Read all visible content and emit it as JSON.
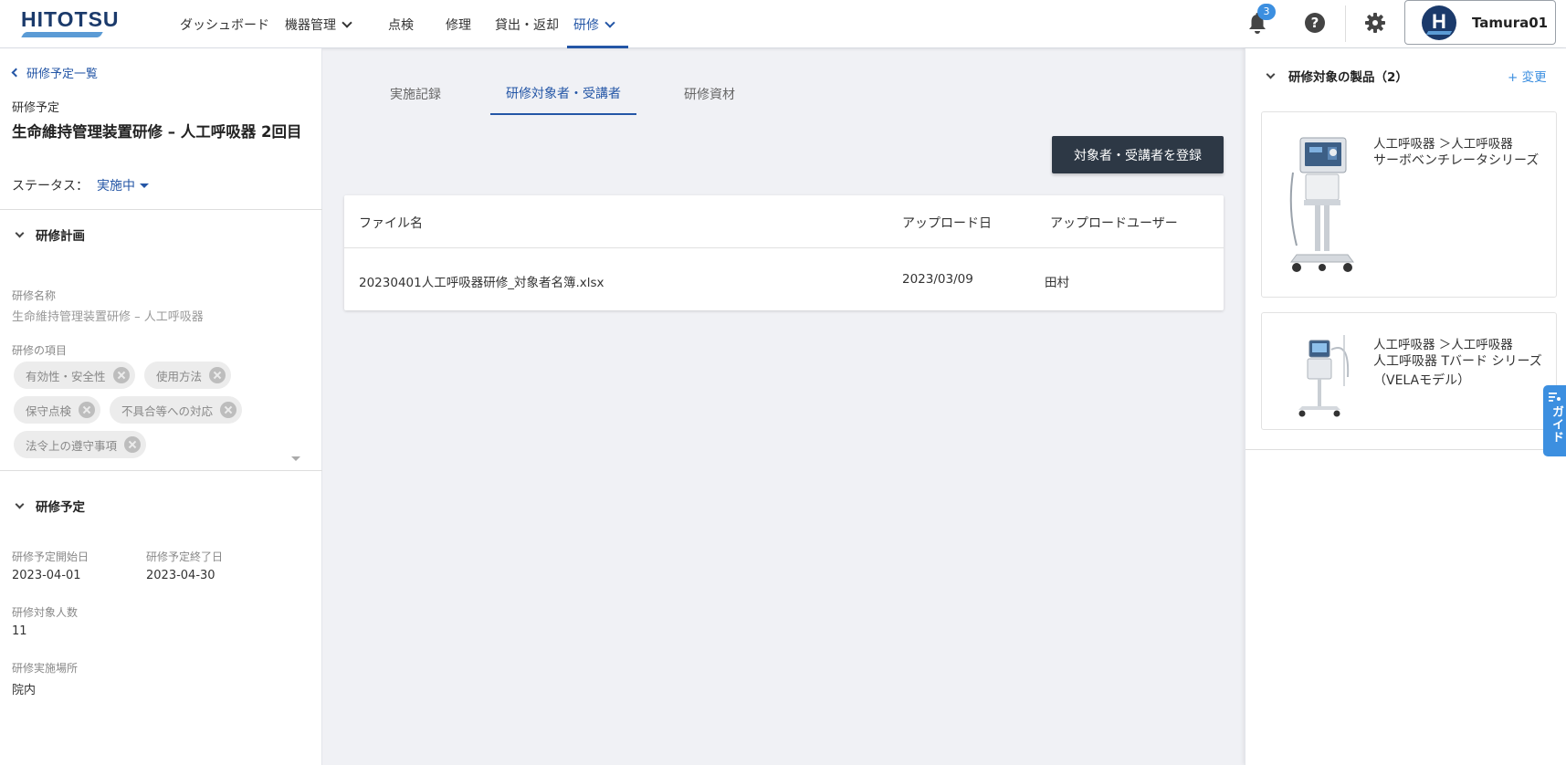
{
  "header": {
    "logo": "HITOTSU",
    "nav": [
      {
        "label": "ダッシュボード"
      },
      {
        "label": "機器管理"
      },
      {
        "label": "点検"
      },
      {
        "label": "修理"
      },
      {
        "label": "貸出・返却"
      },
      {
        "label": "研修"
      }
    ],
    "notification_count": "3",
    "help_glyph": "?",
    "avatar_initial": "H",
    "user_name": "Tamura01"
  },
  "left": {
    "back_link": "研修予定一覧",
    "schedule_label": "研修予定",
    "title": "生命維持管理装置研修 – 人工呼吸器 2回目",
    "status_label": "ステータス：",
    "status_value": "実施中",
    "plan": {
      "heading": "研修計画",
      "name_label": "研修名称",
      "name_value": "生命維持管理装置研修 – 人工呼吸器",
      "items_label": "研修の項目",
      "chips": [
        "有効性・安全性",
        "使用方法",
        "保守点検",
        "不具合等への対応",
        "法令上の遵守事項"
      ]
    },
    "schedule": {
      "heading": "研修予定",
      "start_label": "研修予定開始日",
      "start_value": "2023-04-01",
      "end_label": "研修予定終了日",
      "end_value": "2023-04-30",
      "count_label": "研修対象人数",
      "count_value": "11",
      "place_label": "研修実施場所",
      "place_value": "院内"
    }
  },
  "center": {
    "tabs": [
      {
        "label": "実施記録"
      },
      {
        "label": "研修対象者・受講者"
      },
      {
        "label": "研修資材"
      }
    ],
    "register_button": "対象者・受講者を登録",
    "table": {
      "headers": [
        "ファイル名",
        "アップロード日",
        "アップロードユーザー"
      ],
      "rows": [
        [
          "20230401人工呼吸器研修_対象者名簿.xlsx",
          "2023/03/09",
          "田村"
        ]
      ]
    }
  },
  "right": {
    "heading": "研修対象の製品（2）",
    "change_link": "+ 変更",
    "products": [
      {
        "category": "人工呼吸器 ＞人工呼吸器",
        "name": "サーボベンチレータシリーズ"
      },
      {
        "category": "人工呼吸器 ＞人工呼吸器",
        "name": "人工呼吸器 Tバード シリーズ（VELAモデル）"
      }
    ],
    "guide_label": "ガイド"
  },
  "colors": {
    "primary": "#2456a6",
    "dark_button": "#2d3845",
    "accent": "#3c8fe0",
    "brand": "#1b3a6b"
  }
}
